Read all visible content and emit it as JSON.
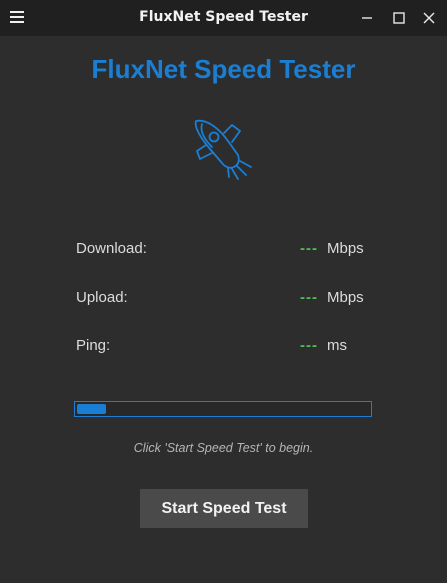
{
  "window": {
    "title": "FluxNet Speed Tester",
    "menu_icon": "hamburger-menu-icon",
    "controls": [
      "minimize-icon",
      "maximize-icon",
      "close-icon"
    ]
  },
  "app": {
    "heading": "FluxNet Speed Tester",
    "logo_icon": "rocket-icon",
    "accent_color": "#1a7fd4",
    "value_color": "#4ec04e"
  },
  "metrics": [
    {
      "label": "Download:",
      "value": "---",
      "unit": "Mbps"
    },
    {
      "label": "Upload:",
      "value": "---",
      "unit": "Mbps"
    },
    {
      "label": "Ping:",
      "value": "---",
      "unit": "ms"
    }
  ],
  "progress": {
    "fraction": 0.1
  },
  "status_text": "Click 'Start Speed Test' to begin.",
  "actions": {
    "start_label": "Start Speed Test"
  }
}
